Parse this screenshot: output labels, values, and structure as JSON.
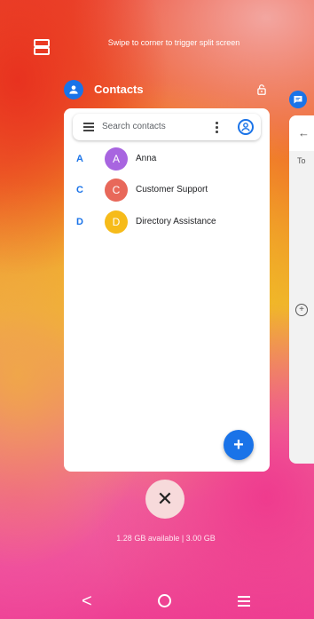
{
  "split_screen": {
    "hint": "Swipe to corner to trigger split screen"
  },
  "app": {
    "title": "Contacts",
    "icon": "person-icon",
    "accent": "#1a73e8"
  },
  "search": {
    "placeholder": "Search contacts"
  },
  "contacts": [
    {
      "section": "A",
      "initial": "A",
      "name": "Anna",
      "color": "#a865e0"
    },
    {
      "section": "C",
      "initial": "C",
      "name": "Customer Support",
      "color": "#e8685a"
    },
    {
      "section": "D",
      "initial": "D",
      "name": "Directory Assistance",
      "color": "#f6bb1a"
    }
  ],
  "fab": {
    "label": "+"
  },
  "side_card": {
    "back_label": "←",
    "to_label": "To"
  },
  "close": {
    "label": "✕"
  },
  "memory": {
    "text": "1.28 GB available | 3.00 GB"
  },
  "nav": {
    "back_label": "<"
  }
}
